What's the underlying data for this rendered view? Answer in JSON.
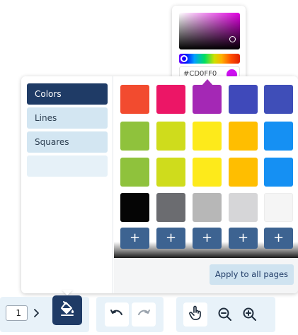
{
  "color_picker": {
    "hex_value": "#CD0FF0",
    "selected_color": "#CD0FF0"
  },
  "sidebar": {
    "items": [
      {
        "label": "Colors",
        "active": true
      },
      {
        "label": "Lines",
        "active": false
      },
      {
        "label": "Squares",
        "active": false
      },
      {
        "label": "",
        "active": false
      }
    ]
  },
  "swatches": {
    "rows": [
      [
        "#f24b2f",
        "#ec1666",
        "#a428b5",
        "#3f49ba",
        "#3f4eb8"
      ],
      [
        "#8fc23c",
        "#cfdc1c",
        "#fdea1b",
        "#ffbe00",
        "#1590f3"
      ],
      [
        "#8fc23c",
        "#cfdc1c",
        "#fdea1b",
        "#ffbe00",
        "#1590f3"
      ],
      [
        "#050505",
        "#6b6c70",
        "#b7b7b7",
        "#d6d6d8",
        "#f5f5f5"
      ]
    ],
    "selected_index": 2,
    "add_label": "+"
  },
  "footer": {
    "apply_label": "Apply to all pages"
  },
  "toolbar": {
    "page_number": "1",
    "next_icon": "chevron-right-icon",
    "fill_icon": "paint-bucket-icon",
    "undo_icon": "undo-icon",
    "redo_icon": "redo-icon",
    "touch_icon": "touch-pointer-icon",
    "zoom_out_icon": "zoom-out-icon",
    "zoom_in_icon": "zoom-in-icon"
  },
  "colors": {
    "accent_dark": "#1f3b66",
    "accent_light": "#d3e6f2",
    "add_button": "#3d6391"
  }
}
